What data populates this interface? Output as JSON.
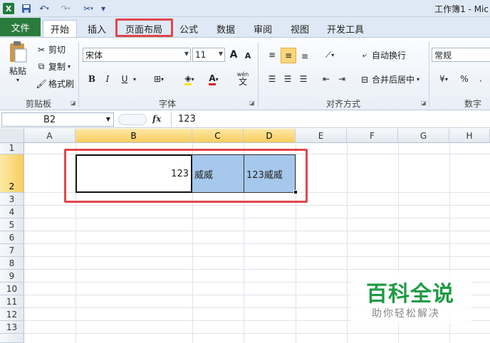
{
  "window": {
    "title": "工作簿1 - Mic"
  },
  "quick_access": {
    "logo": "X",
    "save_icon": "save-icon",
    "undo_icon": "undo-icon",
    "redo_icon": "redo-icon",
    "customize_icon": "customize-icon"
  },
  "tabs": [
    {
      "label": "文件"
    },
    {
      "label": "开始"
    },
    {
      "label": "插入"
    },
    {
      "label": "页面布局"
    },
    {
      "label": "公式"
    },
    {
      "label": "数据"
    },
    {
      "label": "审阅"
    },
    {
      "label": "视图"
    },
    {
      "label": "开发工具"
    }
  ],
  "ribbon": {
    "clipboard": {
      "paste": "粘贴",
      "cut": "剪切",
      "copy": "复制",
      "format_painter": "格式刷",
      "label": "剪贴板"
    },
    "font": {
      "name": "宋体",
      "size": "11",
      "label": "字体",
      "bold": "B",
      "italic": "I",
      "underline": "U",
      "grow": "A",
      "shrink": "A",
      "wen": "wén",
      "wen_char": "文"
    },
    "alignment": {
      "wrap": "自动换行",
      "merge": "合并后居中",
      "label": "对齐方式"
    },
    "number": {
      "format": "常规",
      "label": "数字",
      "percent": "%"
    }
  },
  "formula_bar": {
    "name_box": "B2",
    "fx": "fx",
    "value": "123"
  },
  "grid": {
    "columns": [
      "A",
      "B",
      "C",
      "D",
      "E",
      "F",
      "G",
      "H"
    ],
    "rows": [
      "1",
      "2",
      "3",
      "4",
      "5",
      "6",
      "7",
      "8",
      "9",
      "10",
      "11",
      "12",
      "13"
    ],
    "cells": {
      "B2": "123",
      "C2": "威威",
      "D2": "123威威"
    }
  },
  "watermark": {
    "logo": "百科全说",
    "subtitle": "助你轻松解决"
  },
  "colors": {
    "highlight": "#e0474c",
    "selection_fill": "#a6c8ec",
    "file_tab": "#2b7c3c",
    "watermark_green": "#1e9b45"
  }
}
